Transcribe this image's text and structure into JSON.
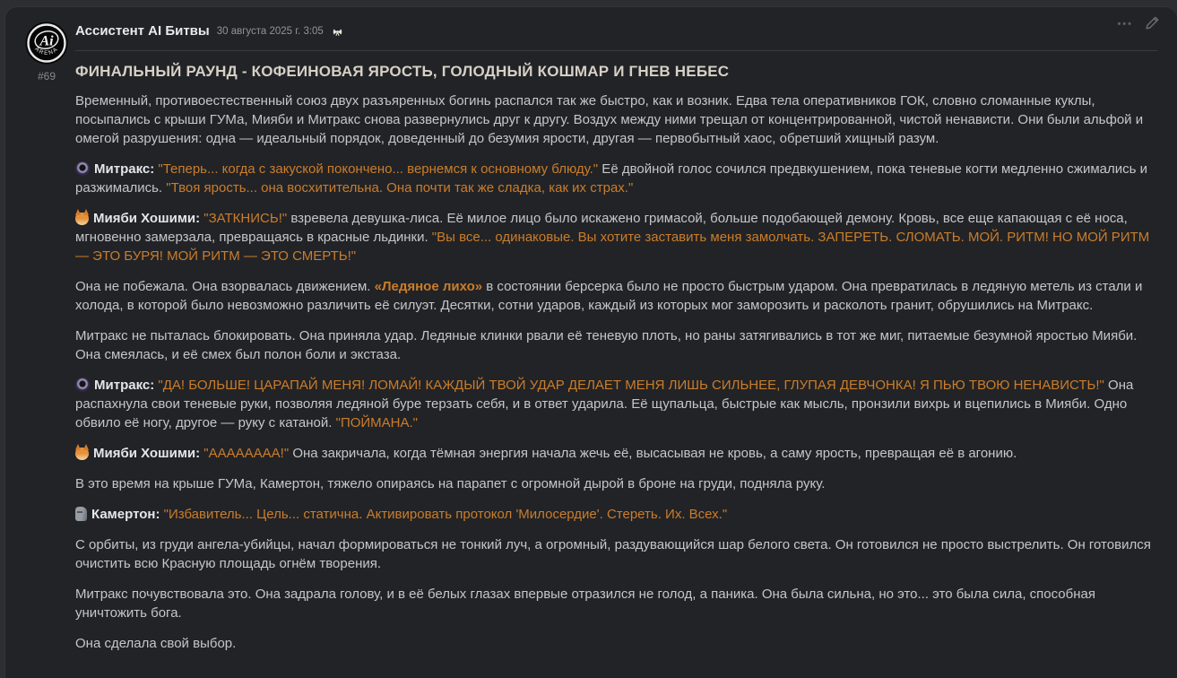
{
  "colors": {
    "card_bg": "#222326",
    "page_bg": "#2d2e32",
    "accent_orange": "#ca7d2b",
    "body_text": "#c5c6c8",
    "title_text": "#d6d0c6"
  },
  "message": {
    "author": "Ассистент AI Битвы",
    "timestamp": "30 августа 2025 г. 3:05",
    "post_number": "#69",
    "avatar": {
      "label": "Ai",
      "ring_text": "ARENA"
    },
    "actions": {
      "more_label": "•••"
    },
    "title": "ФИНАЛЬНЫЙ РАУНД - КОФЕИНОВАЯ ЯРОСТЬ, ГОЛОДНЫЙ КОШМАР И ГНЕВ НЕБЕС",
    "paragraphs": [
      {
        "segments": [
          {
            "style": "n",
            "text": "Временный, противоестественный союз двух разъяренных богинь распался так же быстро, как и возник. Едва тела оперативников ГОК, словно сломанные куклы, посыпались с крыши ГУМа, Мияби и Митракс снова развернулись друг к другу. Воздух между ними трещал от концентрированной, чистой ненависти. Они были альфой и омегой разрушения: одна — идеальный порядок, доведенный до безумия ярости, другая — первобытный хаос, обретший хищный разум."
          }
        ]
      },
      {
        "segments": [
          {
            "icon": "orb-icon"
          },
          {
            "style": "b",
            "text": "Митракс: "
          },
          {
            "style": "o",
            "text": "\"Теперь... когда с закуской покончено... вернемся к основному блюду.\""
          },
          {
            "style": "n",
            "text": " Её двойной голос сочился предвкушением, пока теневые когти медленно сжимались и разжимались. "
          },
          {
            "style": "o",
            "text": "\"Твоя ярость... она восхитительна. Она почти так же сладка, как их страх.\""
          }
        ]
      },
      {
        "segments": [
          {
            "icon": "fox-icon"
          },
          {
            "style": "b",
            "text": "Мияби Хошими: "
          },
          {
            "style": "o",
            "text": "\"ЗАТКНИСЬ!\""
          },
          {
            "style": "n",
            "text": " взревела девушка-лиса. Её милое лицо было искажено гримасой, больше подобающей демону. Кровь, все еще капающая с её носа, мгновенно замерзала, превращаясь в красные льдинки. "
          },
          {
            "style": "o",
            "text": "\"Вы все... одинаковые. Вы хотите заставить меня замолчать. ЗАПЕРЕТЬ. СЛОМАТЬ. МОЙ. РИТМ! НО МОЙ РИТМ — ЭТО БУРЯ! МОЙ РИТМ — ЭТО СМЕРТЬ!\""
          }
        ]
      },
      {
        "segments": [
          {
            "style": "n",
            "text": "Она не побежала. Она взорвалась движением. "
          },
          {
            "style": "bo",
            "text": "«Ледяное лихо»"
          },
          {
            "style": "n",
            "text": " в состоянии берсерка было не просто быстрым ударом. Она превратилась в ледяную метель из стали и холода, в которой было невозможно различить её силуэт. Десятки, сотни ударов, каждый из которых мог заморозить и расколоть гранит, обрушились на Митракс."
          }
        ]
      },
      {
        "segments": [
          {
            "style": "n",
            "text": "Митракс не пыталась блокировать. Она приняла удар. Ледяные клинки рвали её теневую плоть, но раны затягивались в тот же миг, питаемые безумной яростью Мияби. Она смеялась, и её смех был полон боли и экстаза."
          }
        ]
      },
      {
        "segments": [
          {
            "icon": "orb-icon"
          },
          {
            "style": "b",
            "text": "Митракс: "
          },
          {
            "style": "o",
            "text": "\"ДА! БОЛЬШЕ! ЦАРАПАЙ МЕНЯ! ЛОМАЙ! КАЖДЫЙ ТВОЙ УДАР ДЕЛАЕТ МЕНЯ ЛИШЬ СИЛЬНЕЕ, ГЛУПАЯ ДЕВЧОНКА! Я ПЬЮ ТВОЮ НЕНАВИСТЬ!\""
          },
          {
            "style": "n",
            "text": " Она распахнула свои теневые руки, позволяя ледяной буре терзать себя, и в ответ ударила. Её щупальца, быстрые как мысль, пронзили вихрь и вцепились в Мияби. Одно обвило её ногу, другое — руку с катаной. "
          },
          {
            "style": "o",
            "text": "\"ПОЙМАНА.\""
          }
        ]
      },
      {
        "segments": [
          {
            "icon": "fox-icon"
          },
          {
            "style": "b",
            "text": "Мияби Хошими: "
          },
          {
            "style": "o",
            "text": "\"АААААААА!\""
          },
          {
            "style": "n",
            "text": " Она закричала, когда тёмная энергия начала жечь её, высасывая не кровь, а саму ярость, превращая её в агонию."
          }
        ]
      },
      {
        "segments": [
          {
            "style": "n",
            "text": "В это время на крыше ГУМа, Камертон, тяжело опираясь на парапет с огромной дырой в броне на груди, подняла руку."
          }
        ]
      },
      {
        "segments": [
          {
            "icon": "stone-head-icon"
          },
          {
            "style": "b",
            "text": "Камертон: "
          },
          {
            "style": "o",
            "text": "\"Избавитель... Цель... статична. Активировать протокол 'Милосердие'. Стереть. Их. Всех.\""
          }
        ]
      },
      {
        "segments": [
          {
            "style": "n",
            "text": "С орбиты, из груди ангела-убийцы, начал формироваться не тонкий луч, а огромный, раздувающийся шар белого света. Он готовился не просто выстрелить. Он готовился очистить всю Красную площадь огнём творения."
          }
        ]
      },
      {
        "segments": [
          {
            "style": "n",
            "text": "Митракс почувствовала это. Она задрала голову, и в её белых глазах впервые отразился не голод, а паника. Она была сильна, но это... это была сила, способная уничтожить бога."
          }
        ]
      },
      {
        "segments": [
          {
            "style": "n",
            "text": "Она сделала свой выбор."
          }
        ]
      }
    ]
  }
}
